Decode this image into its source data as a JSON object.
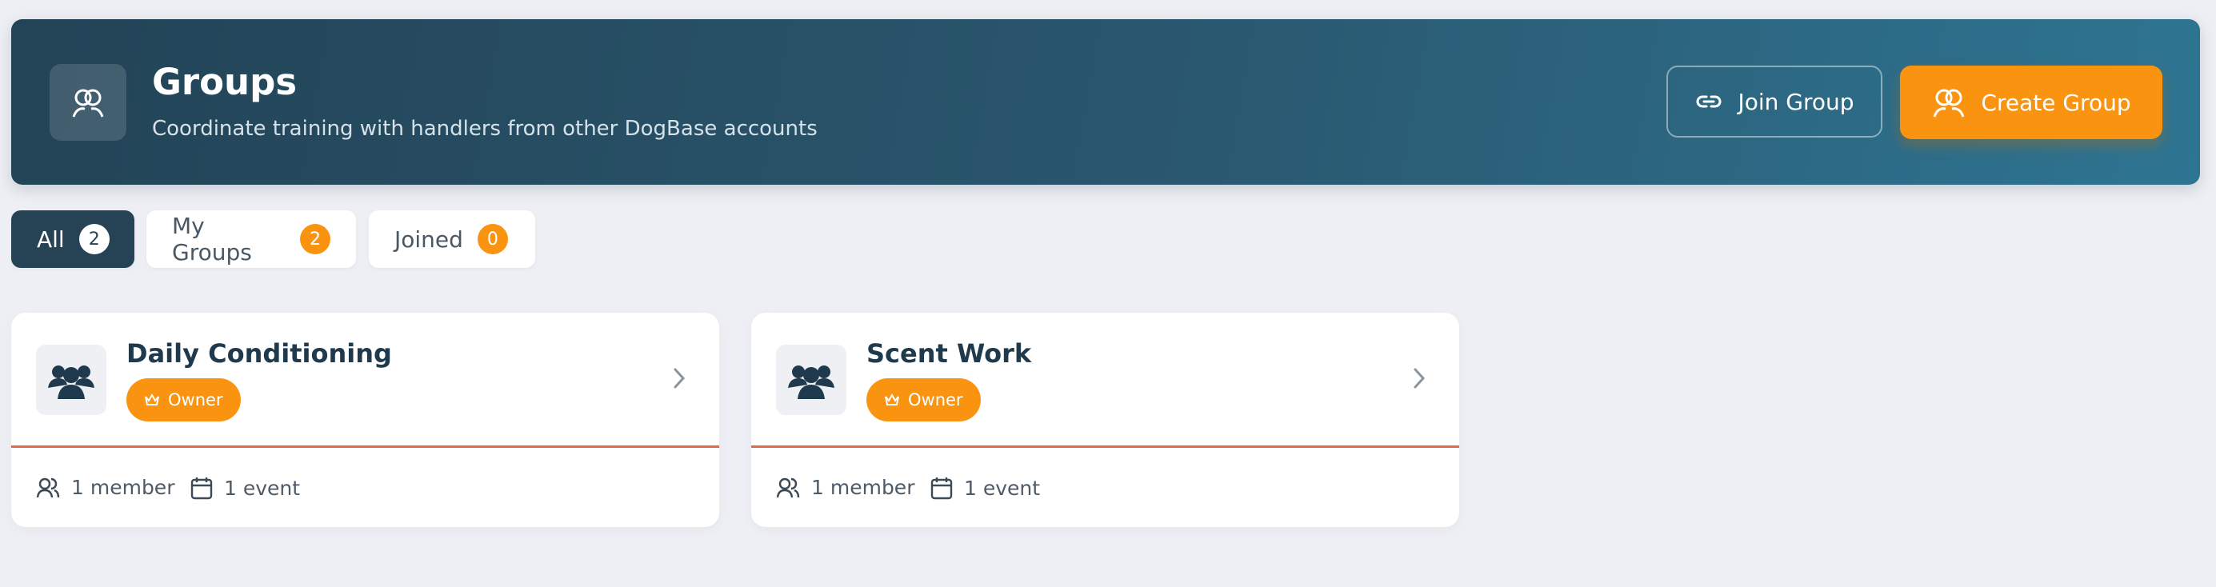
{
  "header": {
    "title": "Groups",
    "subtitle": "Coordinate training with handlers from other DogBase accounts",
    "icon": "groups-icon",
    "join_label": "Join Group",
    "create_label": "Create Group"
  },
  "tabs": [
    {
      "label": "All",
      "count": "2",
      "active": true
    },
    {
      "label": "My Groups",
      "count": "2",
      "active": false
    },
    {
      "label": "Joined",
      "count": "0",
      "active": false
    }
  ],
  "groups": [
    {
      "name": "Daily Conditioning",
      "role": "Owner",
      "members": "1 member",
      "events": "1 event"
    },
    {
      "name": "Scent Work",
      "role": "Owner",
      "members": "1 member",
      "events": "1 event"
    }
  ],
  "colors": {
    "accent": "#fa9410",
    "header_dark": "#234356",
    "divider": "#e06a48"
  }
}
